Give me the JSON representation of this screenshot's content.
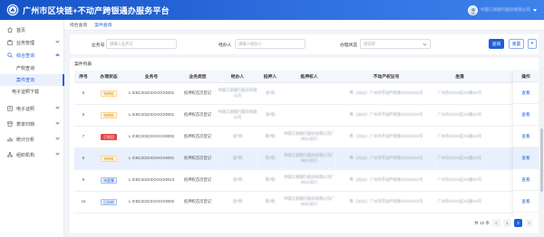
{
  "header": {
    "title": "广州市区块链+不动产跨银通办服务平台",
    "user_name": "中国工商银行股份有限公司"
  },
  "sidebar": {
    "items": [
      {
        "label": "首页",
        "icon": "home-icon"
      },
      {
        "label": "业务管理",
        "icon": "briefcase-icon"
      },
      {
        "label": "综合查询",
        "icon": "search-icon"
      }
    ],
    "sub_items": [
      {
        "label": "产权查询"
      },
      {
        "label": "案件查询"
      },
      {
        "label": "电子证照下载"
      }
    ],
    "items_after": [
      {
        "label": "电子证照",
        "icon": "certificate-icon"
      },
      {
        "label": "表单归档",
        "icon": "archive-icon"
      },
      {
        "label": "统计分析",
        "icon": "chart-icon"
      },
      {
        "label": "组织机构",
        "icon": "org-icon"
      }
    ]
  },
  "tabs": [
    {
      "label": "综合查询"
    },
    {
      "label": "案件查询"
    }
  ],
  "filters": {
    "biz_no_label": "业务号",
    "biz_no_placeholder": "请输入业务号",
    "handler_label": "经办人",
    "handler_placeholder": "请输入经办人",
    "status_label": "办理状态",
    "status_placeholder": "请选择",
    "search_label": "查询",
    "reset_label": "重置",
    "toggle_label": "▾"
  },
  "table": {
    "caption": "案件列表",
    "columns": [
      "序号",
      "办理状态",
      "业务号",
      "业务类型",
      "经办人",
      "抵押人",
      "抵押权人",
      "不动产权证号",
      "坐落",
      "登记时间"
    ],
    "op_header": "操作",
    "op_label": "查看",
    "rows": [
      {
        "no": "5",
        "status": "待审核",
        "status_type": "yellow",
        "biz_no": "L-ICBC2022XXXXXX0001",
        "type": "抵押权首次登记",
        "handler": "中国工商银行股份有限公司",
        "mortgagor": "金*民",
        "mortgagee": "",
        "cert": "粤（2022）广州市不动产权第XXXXXXX号",
        "location": "广州市XXXX区XX路XX号",
        "time": "2022-0"
      },
      {
        "no": "6",
        "status": "待审核",
        "status_type": "yellow",
        "biz_no": "L-ICBC2022XXXXXX0001",
        "type": "抵押权首次登记",
        "handler": "中国工商银行股份有限公司",
        "mortgagor": "金*明",
        "mortgagee": "",
        "cert": "粤（2022）广州市不动产权第XXXXXXX号",
        "location": "广州市XXXX区XX路XX号",
        "time": "2022-0"
      },
      {
        "no": "7",
        "status": "已驳回",
        "status_type": "red",
        "biz_no": "L-ICBC2022XXXXXX0002",
        "type": "抵押权首次登记",
        "handler": "金*明",
        "mortgagor": "陈*明",
        "mortgagee": "中国工商银行股份有限公司广州XX支行",
        "cert": "粤（2022）广州市不动产权第XXXXXXX号",
        "location": "广州市XXXX区XX路XX号",
        "time": "2022-0"
      },
      {
        "no": "8",
        "status": "待审核",
        "status_type": "yellow",
        "biz_no": "L-ICBC2022XXXXXX0001",
        "type": "抵押权首次登记",
        "handler": "金*明",
        "mortgagor": "陈*明",
        "mortgagee": "中国工商银行股份有限公司广州XX支行",
        "cert": "粤（2022）广州市不动产权第XXXXXXX号",
        "location": "广州市XXXX区XX路XX号",
        "time": "2022-0"
      },
      {
        "no": "9",
        "status": "待登簿",
        "status_type": "blue",
        "biz_no": "L-ICBC2022XXXXXX0013",
        "type": "抵押权首次登记",
        "handler": "金*明",
        "mortgagor": "陈*明",
        "mortgagee": "中国工商银行股份有限公司广州XX支行",
        "cert": "粤（2022）广州市不动产权第XXXXXXX号",
        "location": "广州市XXXX区XX路XX号",
        "time": "2022-0"
      },
      {
        "no": "10",
        "status": "已办结",
        "status_type": "blue",
        "biz_no": "L-ICBC2022XXXXXX0002",
        "type": "抵押权首次登记",
        "handler": "金*明",
        "mortgagor": "陈*明",
        "mortgagee": "中国工商银行股份有限公司广州XX支行",
        "cert": "粤（2022）广州市不动产权第XXXXXXX号",
        "location": "广州市XXXX区XX路XX号",
        "time": "2022-0"
      }
    ]
  },
  "pager": {
    "total": "共 10 条",
    "prev": "<",
    "pages": [
      "1",
      "2"
    ],
    "next": ">",
    "active_page": "2"
  },
  "colors": {
    "primary": "#1f5fd6",
    "header_start": "#1553c6",
    "header_end": "#3d82ea",
    "tag_red": "#e54545",
    "tag_yellow": "#d48806"
  }
}
